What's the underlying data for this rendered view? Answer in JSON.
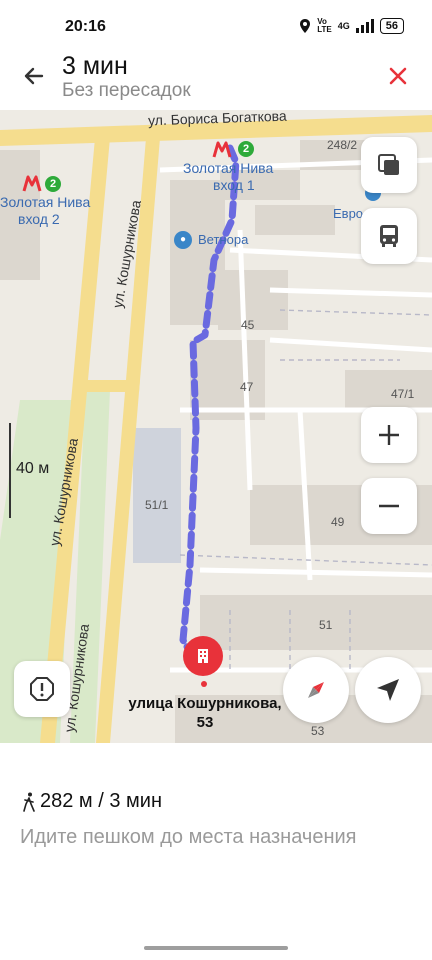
{
  "status_bar": {
    "time": "20:16",
    "network": "4G",
    "battery": "56",
    "icons": [
      "location-icon",
      "volte-icon",
      "signal-icon",
      "battery-icon"
    ]
  },
  "header": {
    "title": "3 мин",
    "subtitle": "Без пересадок",
    "back_icon": "arrow-left-icon",
    "close_icon": "close-icon"
  },
  "map": {
    "street_top": "ул. Бориса Богаткова",
    "street_left_1": "ул. Кошурникова",
    "street_left_2": "ул. Кошурникова",
    "street_left_3": "ул. Кошурникова",
    "metro_1_name": "Золотая Нива",
    "metro_1_exit": "вход 1",
    "metro_2_name": "Золотая Нива",
    "metro_2_exit": "вход 2",
    "metro_line": "2",
    "poi_vetnora": "Ветнора",
    "poi_evroflora": "Евро Флора",
    "houses": [
      "248/2",
      "45",
      "47",
      "47/1",
      "51/1",
      "49",
      "51",
      "53"
    ],
    "scale": "40 м",
    "destination_line1": "улица Кошурникова,",
    "destination_line2": "53",
    "route_color": "#6a6ae0",
    "pin_color": "#e8323a"
  },
  "route_info": {
    "distance_time": "282 м / 3 мин",
    "hint": "Идите пешком до места назначения"
  }
}
